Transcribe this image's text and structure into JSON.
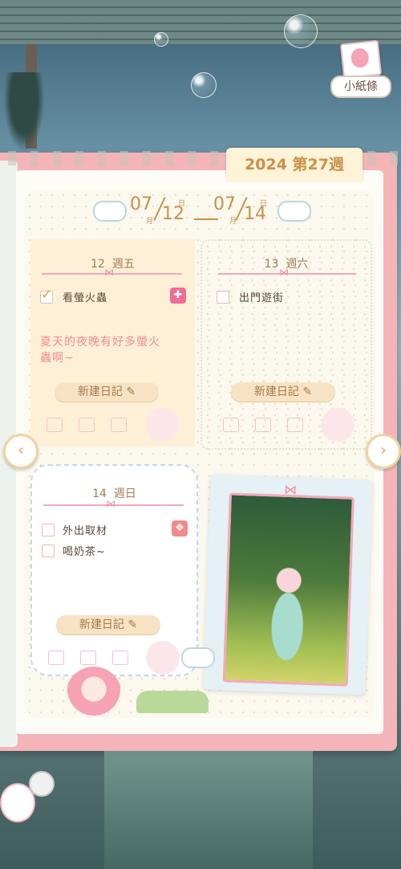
{
  "header": {
    "note_button_label": "小紙條",
    "week_tab": "2024 第27週"
  },
  "date_range": {
    "start_month": "07",
    "start_day": "12",
    "end_month": "07",
    "end_day": "14",
    "month_unit": "月",
    "day_unit": "日"
  },
  "days": [
    {
      "date": "12",
      "weekday": "週五",
      "tasks": [
        {
          "text": "看螢火蟲",
          "done": true
        }
      ],
      "memo_line1": "夏天的夜晚有好多螢火",
      "memo_line2": "蟲啊~",
      "new_entry": "新建日記"
    },
    {
      "date": "13",
      "weekday": "週六",
      "tasks": [
        {
          "text": "出門遊街",
          "done": false
        }
      ],
      "new_entry": "新建日記"
    },
    {
      "date": "14",
      "weekday": "週日",
      "tasks": [
        {
          "text": "外出取材",
          "done": false
        },
        {
          "text": "喝奶茶~",
          "done": false
        }
      ],
      "new_entry": "新建日記"
    }
  ],
  "nav": {
    "prev_glyph": "‹",
    "next_glyph": "›"
  },
  "icons": {
    "edit": "edit-icon",
    "gift": "gift-icon",
    "note": "note-icon"
  },
  "colors": {
    "accent": "#c9914a",
    "pink": "#f5b4b8",
    "memo": "#ee8c92"
  }
}
